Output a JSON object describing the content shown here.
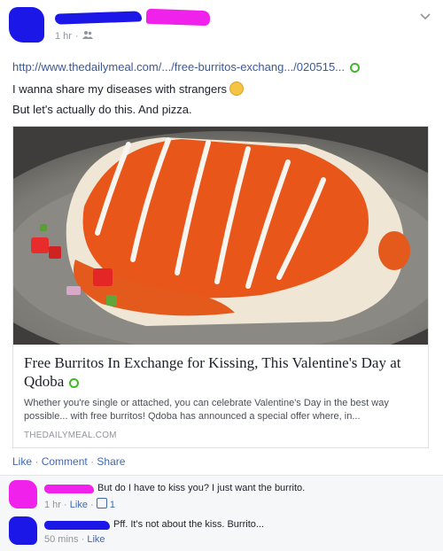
{
  "post": {
    "time": "1 hr",
    "audience_icon": "friends-icon",
    "link": "http://www.thedailymeal.com/.../free-burritos-exchang.../020515...",
    "message_line1": "I wanna share my diseases with strangers",
    "message_line2": "But let's actually do this. And pizza."
  },
  "card": {
    "title": "Free Burritos In Exchange for Kissing, This Valentine's Day at Qdoba",
    "description": "Whether you're single or attached, you can celebrate Valentine's Day in the best way possible... with free burritos! Qdoba has announced a special offer where, in...",
    "source": "THEDAILYMEAL.COM"
  },
  "actions": {
    "like": "Like",
    "comment": "Comment",
    "share": "Share",
    "separator": "·"
  },
  "comments": [
    {
      "text": "But do I have to kiss you? I just want the burrito.",
      "time": "1 hr",
      "like": "Like",
      "like_count": "1",
      "avatar_color": "#ef21ea",
      "name_color": "#ef21ea"
    },
    {
      "text": "Pff. It's not about the kiss. Burrito...",
      "time": "50 mins",
      "like": "Like",
      "avatar_color": "#1b17e6",
      "name_color": "#1b17e6"
    }
  ],
  "colors": {
    "link": "#3b5998",
    "action": "#4267b2",
    "muted": "#90949c",
    "redaction_blue": "#1b17e6",
    "redaction_pink": "#ef21ea"
  }
}
